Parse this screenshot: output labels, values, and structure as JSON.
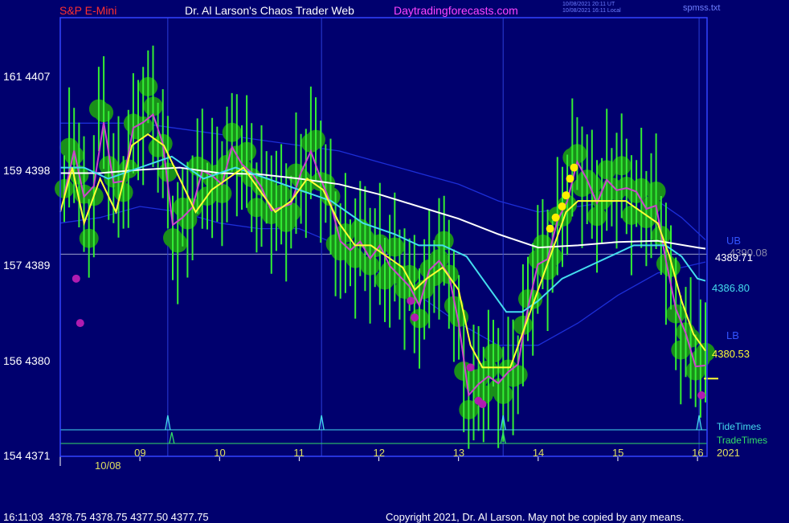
{
  "header": {
    "symbol": "S&P E-Mini",
    "title": "Dr. Al Larson's Chaos Trader Web",
    "site": "Daytradingforecasts.com",
    "timestamp_ut": "10/08/2021 20:11 UT",
    "timestamp_local": "10/08/2021 16:11 Local",
    "filename": "spmss.txt"
  },
  "footer": {
    "quote": "16:11:03  4378.75 4378.75 4377.50 4377.75",
    "copyright": "Copyright 2021, Dr. Al Larson. May not be copied by any means."
  },
  "colors": {
    "background": "#00006e",
    "frame": "#3344ff",
    "price": "#33ee33",
    "price_bubble": "#1a8f1a",
    "fast_ma": "#ffff33",
    "slow_ma": "#44ddee",
    "long_ma": "#ffffff",
    "mid_ma": "#cc44cc",
    "band": "#1c2ed8",
    "tide_times": "#44ddee",
    "trade_times": "#33dd66",
    "red_title": "#ff3030",
    "magenta_site": "#ff44ff",
    "yellow_marker": "#ffee00"
  },
  "chart_data": {
    "type": "line",
    "title": "S&P E-Mini",
    "date_label": "10/08",
    "year_label": "2021",
    "y_ticks": [
      {
        "value": 4407,
        "label": "161  4407"
      },
      {
        "value": 4398,
        "label": "159  4398"
      },
      {
        "value": 4389,
        "label": "157  4389"
      },
      {
        "value": 4380,
        "label": "156  4380"
      },
      {
        "value": 4371,
        "label": "154  4371"
      }
    ],
    "x_ticks": [
      "09",
      "10",
      "11",
      "12",
      "13",
      "14",
      "15",
      "16"
    ],
    "x_tick_hours": [
      9,
      10,
      11,
      12,
      13,
      14,
      15,
      16
    ],
    "xlim": [
      8.0,
      16.12
    ],
    "ylim": [
      4371,
      4410.5
    ],
    "reference_level": 4389.2,
    "series": [
      {
        "key": "price",
        "x": [
          8.05,
          8.2,
          8.35,
          8.5,
          8.7,
          8.9,
          9.1,
          9.3,
          9.45,
          9.6,
          9.8,
          10.0,
          10.2,
          10.4,
          10.6,
          10.8,
          11.0,
          11.2,
          11.4,
          11.6,
          11.8,
          12.0,
          12.2,
          12.4,
          12.55,
          12.7,
          12.9,
          13.1,
          13.25,
          13.45,
          13.6,
          13.8,
          14.0,
          14.2,
          14.35,
          14.5,
          14.7,
          14.9,
          15.1,
          15.3,
          15.5,
          15.6,
          15.75,
          15.9,
          16.0,
          16.1
        ],
        "y": [
          4394,
          4400,
          4391,
          4402,
          4394,
          4400,
          4402,
          4399,
          4391,
          4392,
          4397,
          4396,
          4398,
          4397,
          4394,
          4392,
          4397,
          4398,
          4393,
          4390,
          4389,
          4390,
          4388,
          4385,
          4386,
          4389,
          4387,
          4378,
          4377,
          4378,
          4378,
          4381,
          4388,
          4391,
          4394,
          4397,
          4395,
          4395,
          4395,
          4395,
          4392,
          4389,
          4384,
          4381,
          4379,
          4378
        ]
      },
      {
        "key": "fast_ma",
        "x": [
          8.0,
          8.15,
          8.3,
          8.5,
          8.7,
          8.9,
          9.1,
          9.3,
          9.5,
          9.7,
          9.9,
          10.1,
          10.3,
          10.5,
          10.7,
          10.9,
          11.1,
          11.3,
          11.5,
          11.7,
          11.9,
          12.1,
          12.3,
          12.45,
          12.6,
          12.8,
          13.0,
          13.15,
          13.3,
          13.5,
          13.65,
          13.8,
          14.0,
          14.2,
          14.35,
          14.5,
          14.7,
          14.9,
          15.1,
          15.3,
          15.5,
          15.65,
          15.8,
          15.95,
          16.1
        ],
        "y": [
          4393,
          4397,
          4392,
          4396,
          4393,
          4399,
          4400,
          4399,
          4396,
          4393,
          4395,
          4396,
          4397,
          4395,
          4393,
          4394,
          4396,
          4395,
          4392,
          4390,
          4390,
          4389,
          4388,
          4386,
          4387,
          4388,
          4386,
          4381,
          4379,
          4379,
          4379,
          4382,
          4386,
          4390,
          4393,
          4394,
          4394,
          4394,
          4394,
          4393,
          4392,
          4389,
          4385,
          4382,
          4380.5
        ]
      },
      {
        "key": "slow_ma",
        "x": [
          8.0,
          8.3,
          8.6,
          9.0,
          9.4,
          9.8,
          10.2,
          10.6,
          11.0,
          11.4,
          11.8,
          12.2,
          12.5,
          12.8,
          13.1,
          13.4,
          13.6,
          13.8,
          14.0,
          14.3,
          14.6,
          14.9,
          15.2,
          15.4,
          15.6,
          15.8,
          16.0,
          16.1
        ],
        "y": [
          4397,
          4397,
          4396,
          4397,
          4398,
          4396,
          4397,
          4396,
          4395,
          4394,
          4392,
          4391,
          4390,
          4390,
          4389,
          4386,
          4384,
          4384,
          4385,
          4387,
          4388,
          4389,
          4390,
          4390,
          4390,
          4389,
          4387,
          4386.8
        ]
      },
      {
        "key": "long_ma",
        "x": [
          8.0,
          8.5,
          9.0,
          9.5,
          10.0,
          10.5,
          11.0,
          11.5,
          12.0,
          12.5,
          13.0,
          13.5,
          14.0,
          14.5,
          15.0,
          15.5,
          16.0,
          16.1
        ],
        "y": [
          4396.5,
          4396.5,
          4396.8,
          4397,
          4396.5,
          4396.4,
          4396,
          4395.5,
          4394.6,
          4393.5,
          4392.4,
          4391,
          4389.8,
          4390,
          4390.3,
          4390.4,
          4389.8,
          4389.7
        ]
      },
      {
        "key": "upper_band",
        "x": [
          8.0,
          8.5,
          9.0,
          9.5,
          10.0,
          10.5,
          11.0,
          11.5,
          12.0,
          12.5,
          13.0,
          13.5,
          14.0,
          14.5,
          15.0,
          15.5,
          15.8,
          16.1
        ],
        "y": [
          4401,
          4401,
          4401,
          4400.5,
          4400,
          4399.5,
          4399,
          4398.5,
          4397.5,
          4396.5,
          4395.5,
          4394,
          4393,
          4393.5,
          4394,
          4394,
          4392.5,
          4390.5
        ]
      },
      {
        "key": "lower_band",
        "x": [
          8.0,
          8.5,
          9.0,
          9.5,
          10.0,
          10.5,
          11.0,
          11.5,
          12.0,
          12.5,
          13.0,
          13.5,
          14.0,
          14.5,
          15.0,
          15.5,
          15.8,
          16.1
        ],
        "y": [
          4392,
          4392.5,
          4393.5,
          4393,
          4392,
          4391.5,
          4391.5,
          4390,
          4387.5,
          4385.5,
          4383,
          4381,
          4381,
          4383,
          4385.5,
          4387.5,
          4388,
          4388.5
        ]
      }
    ],
    "right_labels": {
      "ub": "UB",
      "long_value": "4389.71",
      "other_value": "4390.08",
      "slow_value": "4386.80",
      "lb": "LB",
      "fast_value": "4380.53",
      "tide_times": "TideTimes",
      "trade_times": "TradeTimes"
    },
    "tide_time_hours": [
      9.35,
      11.28,
      13.56,
      16.02
    ],
    "trade_time_hours": [
      9.4,
      13.56
    ]
  }
}
